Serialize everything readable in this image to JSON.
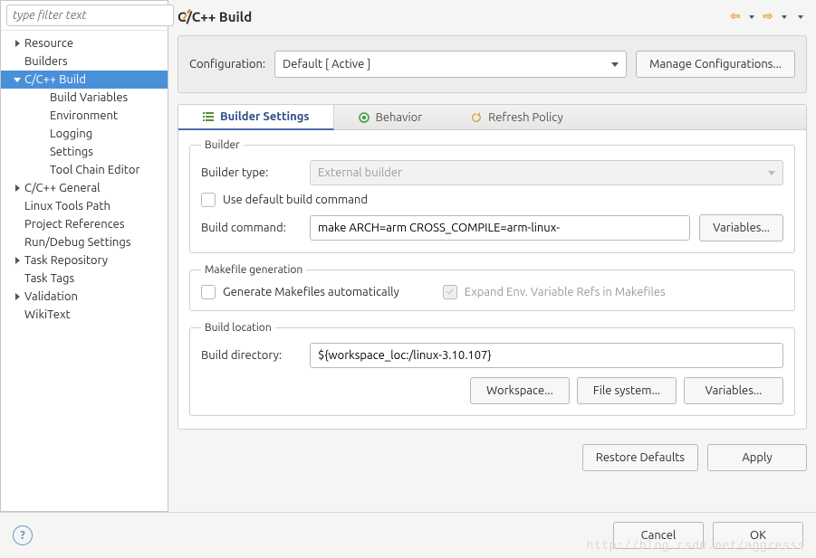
{
  "sidebar": {
    "filter_placeholder": "type filter text",
    "items": [
      {
        "label": "Resource",
        "twisty": "right",
        "indent": "top"
      },
      {
        "label": "Builders",
        "twisty": "",
        "indent": "top"
      },
      {
        "label": "C/C++ Build",
        "twisty": "down",
        "indent": "top",
        "selected": true
      },
      {
        "label": "Build Variables",
        "twisty": "",
        "indent": "child"
      },
      {
        "label": "Environment",
        "twisty": "",
        "indent": "child"
      },
      {
        "label": "Logging",
        "twisty": "",
        "indent": "child"
      },
      {
        "label": "Settings",
        "twisty": "",
        "indent": "child"
      },
      {
        "label": "Tool Chain Editor",
        "twisty": "",
        "indent": "child"
      },
      {
        "label": "C/C++ General",
        "twisty": "right",
        "indent": "top"
      },
      {
        "label": "Linux Tools Path",
        "twisty": "",
        "indent": "top"
      },
      {
        "label": "Project References",
        "twisty": "",
        "indent": "top"
      },
      {
        "label": "Run/Debug Settings",
        "twisty": "",
        "indent": "top"
      },
      {
        "label": "Task Repository",
        "twisty": "right",
        "indent": "top"
      },
      {
        "label": "Task Tags",
        "twisty": "",
        "indent": "top"
      },
      {
        "label": "Validation",
        "twisty": "right",
        "indent": "top"
      },
      {
        "label": "WikiText",
        "twisty": "",
        "indent": "top"
      }
    ]
  },
  "main": {
    "title": "C/C++ Build",
    "config_label": "Configuration:",
    "config_value": "Default  [ Active ]",
    "manage_config": "Manage Configurations...",
    "tabs": {
      "builder": "Builder Settings",
      "behavior": "Behavior",
      "refresh": "Refresh Policy"
    },
    "builder": {
      "legend": "Builder",
      "type_label": "Builder type:",
      "type_value": "External builder",
      "use_default_label": "Use default build command",
      "cmd_label": "Build command:",
      "cmd_value": "make ARCH=arm CROSS_COMPILE=arm-linux-",
      "variables_btn": "Variables..."
    },
    "makegen": {
      "legend": "Makefile generation",
      "generate_label": "Generate Makefiles automatically",
      "expand_label": "Expand Env. Variable Refs in Makefiles"
    },
    "loc": {
      "legend": "Build location",
      "dir_label": "Build directory:",
      "dir_value": "${workspace_loc:/linux-3.10.107}",
      "workspace_btn": "Workspace...",
      "filesystem_btn": "File system...",
      "variables_btn": "Variables..."
    },
    "restore": "Restore Defaults",
    "apply": "Apply"
  },
  "dialog": {
    "cancel": "Cancel",
    "ok": "OK"
  },
  "watermark": "http://blog.csdn.net/aggresss"
}
